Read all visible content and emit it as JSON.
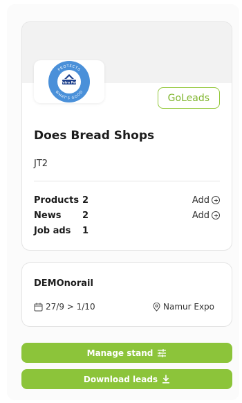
{
  "exhibitor": {
    "logo_text": {
      "top": "PROTECTS",
      "brand": "Tetra Pak",
      "bottom": "WHAT'S GOOD"
    },
    "goleads_label": "GoLeads",
    "company_name": "Does Bread Shops",
    "stand_code": "JT2",
    "stats": [
      {
        "label": "Products",
        "count": "2",
        "add_label": "Add"
      },
      {
        "label": "News",
        "count": "2",
        "add_label": "Add"
      },
      {
        "label": "Job ads",
        "count": "1"
      }
    ]
  },
  "event": {
    "name": "DEMOnorail",
    "dates": "27/9 > 1/10",
    "venue": "Namur Expo"
  },
  "actions": {
    "manage_stand": "Manage stand",
    "download_leads": "Download leads"
  },
  "colors": {
    "accent": "#8cc43a",
    "accent_text": "#7fb52c",
    "logo_blue": "#4a90d9",
    "logo_dark": "#1c3f8c"
  },
  "icons": {
    "add": "plus-circle-icon",
    "calendar": "calendar-icon",
    "location": "location-pin-icon",
    "manage": "sliders-icon",
    "download": "download-icon"
  }
}
